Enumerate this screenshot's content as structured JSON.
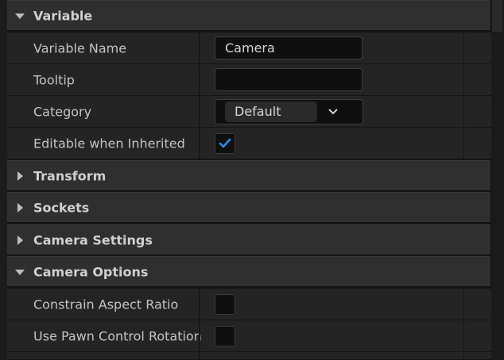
{
  "sections": {
    "variable": "Variable",
    "transform": "Transform",
    "sockets": "Sockets",
    "camera_settings": "Camera Settings",
    "camera_options": "Camera Options"
  },
  "variable": {
    "name_label": "Variable Name",
    "name_value": "Camera",
    "tooltip_label": "Tooltip",
    "tooltip_value": "",
    "category_label": "Category",
    "category_value": "Default",
    "editable_label": "Editable when Inherited",
    "editable_checked": true
  },
  "camera_options": {
    "constrain_label": "Constrain Aspect Ratio",
    "constrain_checked": false,
    "pawn_label": "Use Pawn Control Rotation",
    "pawn_checked": false
  },
  "colors": {
    "check_accent": "#2f8be6",
    "section_bg": "#2f2f2f",
    "row_bg": "#242424"
  },
  "icons": {
    "expanded": "triangle-down-icon",
    "collapsed": "triangle-right-icon",
    "combo": "chevron-down-icon",
    "check": "check-icon"
  }
}
